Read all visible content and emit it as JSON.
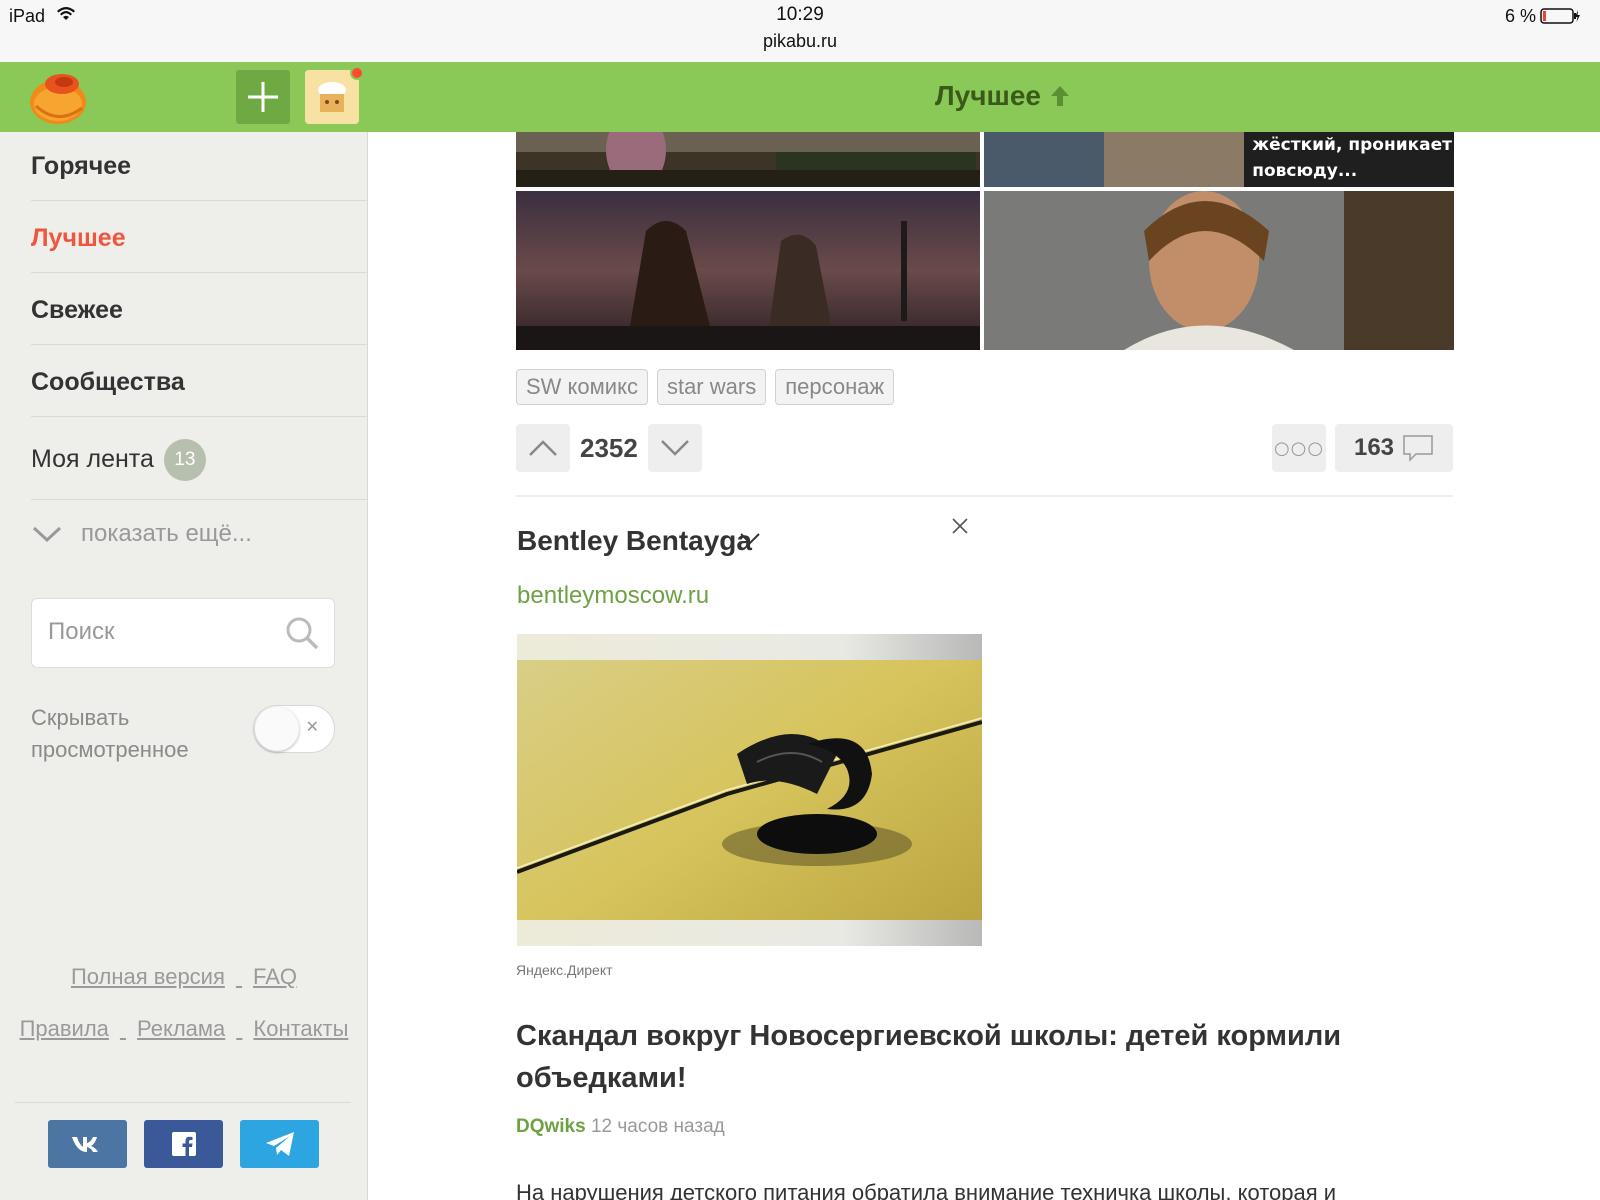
{
  "status_bar": {
    "device": "iPad",
    "time": "10:29",
    "url": "pikabu.ru",
    "battery": "6 %"
  },
  "header": {
    "title": "Лучшее",
    "colors": {
      "bar": "#8ac858",
      "title": "#3a5a1a",
      "notification_dot": "#ff4b2f"
    }
  },
  "sidebar": {
    "nav": [
      {
        "label": "Горячее",
        "active": false
      },
      {
        "label": "Лучшее",
        "active": true
      },
      {
        "label": "Свежее",
        "active": false
      },
      {
        "label": "Сообщества",
        "active": false
      }
    ],
    "my_feed": {
      "label": "Моя лента",
      "count": "13"
    },
    "show_more": "показать ещё...",
    "search": {
      "placeholder": "Поиск",
      "value": ""
    },
    "hide_viewed": {
      "label": "Скрывать просмотренное",
      "enabled": false
    },
    "footer_row1": [
      "Полная версия",
      "FAQ"
    ],
    "footer_row2": [
      "Правила",
      "Реклама",
      "Контакты"
    ],
    "social": [
      "vk-icon",
      "facebook-icon",
      "telegram-icon"
    ],
    "active_color": "#f0563d"
  },
  "post": {
    "image_caption_line1": "жёсткий, проникает",
    "image_caption_line2": "повсюду...",
    "tags": [
      "SW комикс",
      "star wars",
      "персонаж"
    ],
    "rating": "2352",
    "comments": "163"
  },
  "ad": {
    "title": "Bentley Bentayga",
    "url": "bentleymoscow.ru",
    "source": "Яндекс.Директ"
  },
  "next_post": {
    "title": "Скандал вокруг Новосергиевской школы: детей кормили объедками!",
    "author": "DQwiks",
    "time": "12 часов назад",
    "body": "На нарушения детского питания обратила внимание техничка школы, которая и"
  }
}
